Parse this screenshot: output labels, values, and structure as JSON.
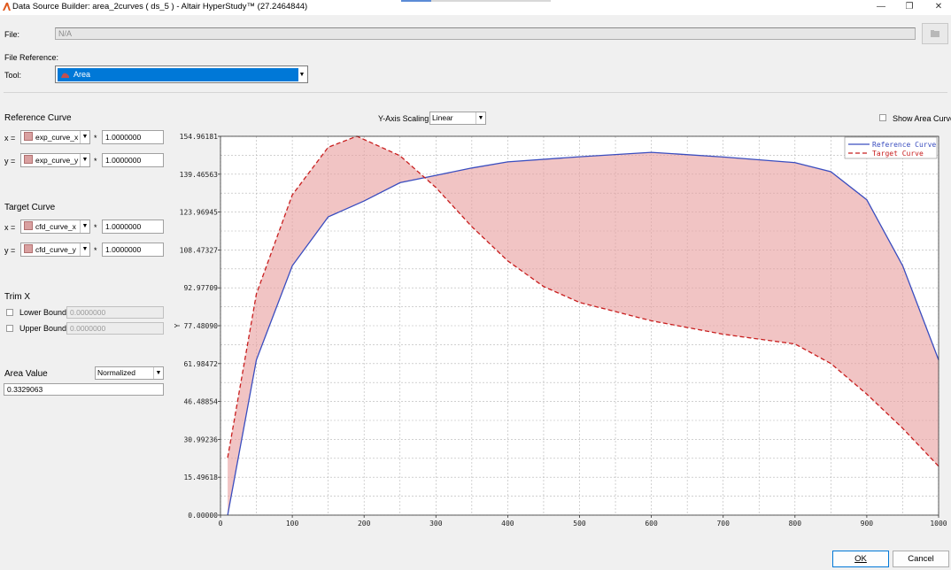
{
  "window": {
    "title": "Data Source Builder: area_2curves ( ds_5 ) - Altair HyperStudy™ (27.2464844)",
    "minimize_glyph": "—",
    "maximize_glyph": "❐",
    "close_glyph": "✕"
  },
  "file": {
    "label": "File:",
    "value": "N/A"
  },
  "file_reference": {
    "label": "File Reference:"
  },
  "tool": {
    "label": "Tool:",
    "value": "Area"
  },
  "reference_curve": {
    "title": "Reference Curve",
    "x_label": "x =",
    "x_source": "exp_curve_x",
    "x_multiplier": "1.0000000",
    "y_label": "y =",
    "y_source": "exp_curve_y",
    "y_multiplier": "1.0000000"
  },
  "target_curve": {
    "title": "Target Curve",
    "x_label": "x =",
    "x_source": "cfd_curve_x",
    "x_multiplier": "1.0000000",
    "y_label": "y =",
    "y_source": "cfd_curve_y",
    "y_multiplier": "1.0000000"
  },
  "multiply_symbol": "*",
  "dropdown_glyph": "▼",
  "trim_x": {
    "title": "Trim X",
    "lower_label": "Lower Bound",
    "lower_value": "0.0000000",
    "upper_label": "Upper Bound",
    "upper_value": "0.0000000"
  },
  "area_value": {
    "title": "Area Value",
    "mode": "Normalized",
    "value": "0.3329063"
  },
  "y_axis_scaling": {
    "label": "Y-Axis Scaling:",
    "value": "Linear"
  },
  "show_area_curve": {
    "label": "Show Area Curve",
    "checked": false
  },
  "buttons": {
    "ok": "OK",
    "cancel": "Cancel"
  },
  "colors": {
    "reference": "#3a4dbf",
    "target": "#c81e1e",
    "area_fill": "#e8a0a0",
    "selection": "#0078d7"
  },
  "chart_data": {
    "type": "line",
    "title": "",
    "xlabel": "",
    "ylabel": "Y",
    "xlim": [
      0,
      1000
    ],
    "ylim": [
      0,
      154.96181
    ],
    "grid": true,
    "legend_position": "top-right",
    "x_ticks": [
      "0",
      "100",
      "200",
      "300",
      "400",
      "500",
      "600",
      "700",
      "800",
      "900",
      "1000"
    ],
    "y_ticks": [
      "0.00000",
      "15.49618",
      "30.99236",
      "46.48854",
      "61.98472",
      "77.48090",
      "92.97709",
      "108.47327",
      "123.96945",
      "139.46563",
      "154.96181"
    ],
    "series": [
      {
        "name": "Reference Curve",
        "x": [
          10,
          50,
          100,
          150,
          200,
          250,
          300,
          350,
          400,
          500,
          600,
          700,
          800,
          850,
          900,
          950,
          1000
        ],
        "y": [
          0,
          63.5,
          102,
          122,
          128.5,
          136,
          139,
          142,
          144.5,
          146.6,
          148.4,
          146.5,
          144.2,
          140.5,
          129,
          102,
          63.5
        ]
      },
      {
        "name": "Target Curve",
        "x": [
          10,
          50,
          100,
          150,
          190,
          250,
          300,
          350,
          400,
          450,
          500,
          600,
          700,
          800,
          850,
          900,
          950,
          1000
        ],
        "y": [
          23.5,
          90.5,
          131,
          150.5,
          155,
          147,
          134,
          118,
          104,
          93.5,
          87,
          79.5,
          74,
          70,
          62,
          49.5,
          35.5,
          20
        ]
      }
    ]
  }
}
